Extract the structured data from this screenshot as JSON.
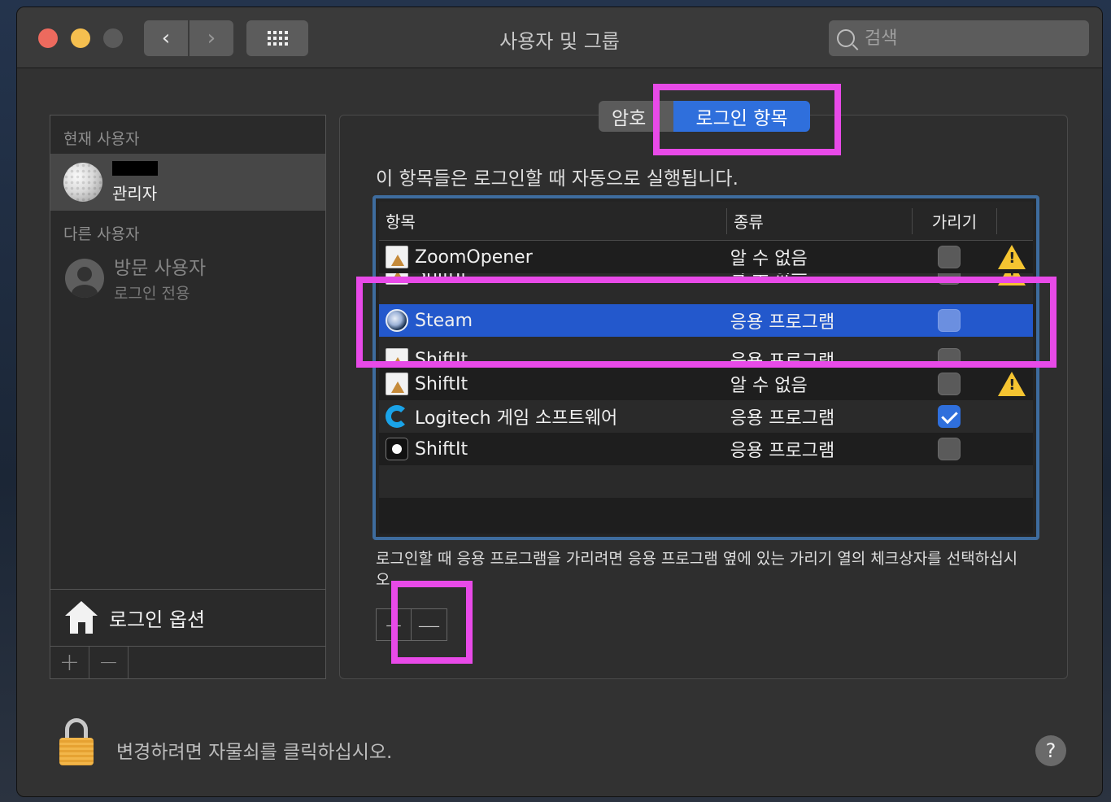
{
  "window": {
    "title": "사용자 및 그룹",
    "search_placeholder": "검색",
    "nav_back": "‹",
    "nav_forward": "›"
  },
  "sidebar": {
    "current_user_label": "현재 사용자",
    "current_user_role": "관리자",
    "other_users_label": "다른 사용자",
    "guest_name": "방문 사용자",
    "guest_sub": "로그인 전용",
    "login_options": "로그인 옵션",
    "add_button": "+",
    "remove_button": "−"
  },
  "panel": {
    "tab_password": "암호",
    "tab_login_items": "로그인 항목",
    "description": "이 항목들은 로그인할 때 자동으로 실행됩니다.",
    "columns": {
      "item": "항목",
      "kind": "종류",
      "hide": "가리기"
    },
    "rows": [
      {
        "name": "ZoomOpener",
        "kind": "알 수 없음",
        "icon": "document-icon",
        "hide": false,
        "warning": true,
        "selected": false,
        "partial": ""
      },
      {
        "name": "ShiftIt",
        "kind": "알 수 없음",
        "icon": "document-icon",
        "hide": false,
        "warning": true,
        "selected": false,
        "partial": "top"
      },
      {
        "name": "Steam",
        "kind": "응용 프로그램",
        "icon": "steam-icon",
        "hide": false,
        "warning": false,
        "selected": true,
        "partial": ""
      },
      {
        "name": "ShiftIt",
        "kind": "응용 프로그램",
        "icon": "document-icon",
        "hide": false,
        "warning": false,
        "selected": false,
        "partial": "bottom"
      },
      {
        "name": "ShiftIt",
        "kind": "알 수 없음",
        "icon": "document-icon",
        "hide": false,
        "warning": true,
        "selected": false,
        "partial": ""
      },
      {
        "name": "Logitech 게임 소프트웨어",
        "kind": "응용 프로그램",
        "icon": "logitech-icon",
        "hide": true,
        "warning": false,
        "selected": false,
        "partial": ""
      },
      {
        "name": "ShiftIt",
        "kind": "응용 프로그램",
        "icon": "shiftit-icon",
        "hide": false,
        "warning": false,
        "selected": false,
        "partial": ""
      }
    ],
    "hint": "로그인할 때 응용 프로그램을 가리려면 응용 프로그램 옆에 있는 가리기 열의 체크상자를 선택하십시오.",
    "add_button": "+",
    "remove_button": "—"
  },
  "footer": {
    "lock_text": "변경하려면 자물쇠를 클릭하십시오.",
    "help": "?"
  },
  "colors": {
    "highlight": "#e84ae8",
    "selection": "#2358cc",
    "accent": "#2f6fdc"
  }
}
